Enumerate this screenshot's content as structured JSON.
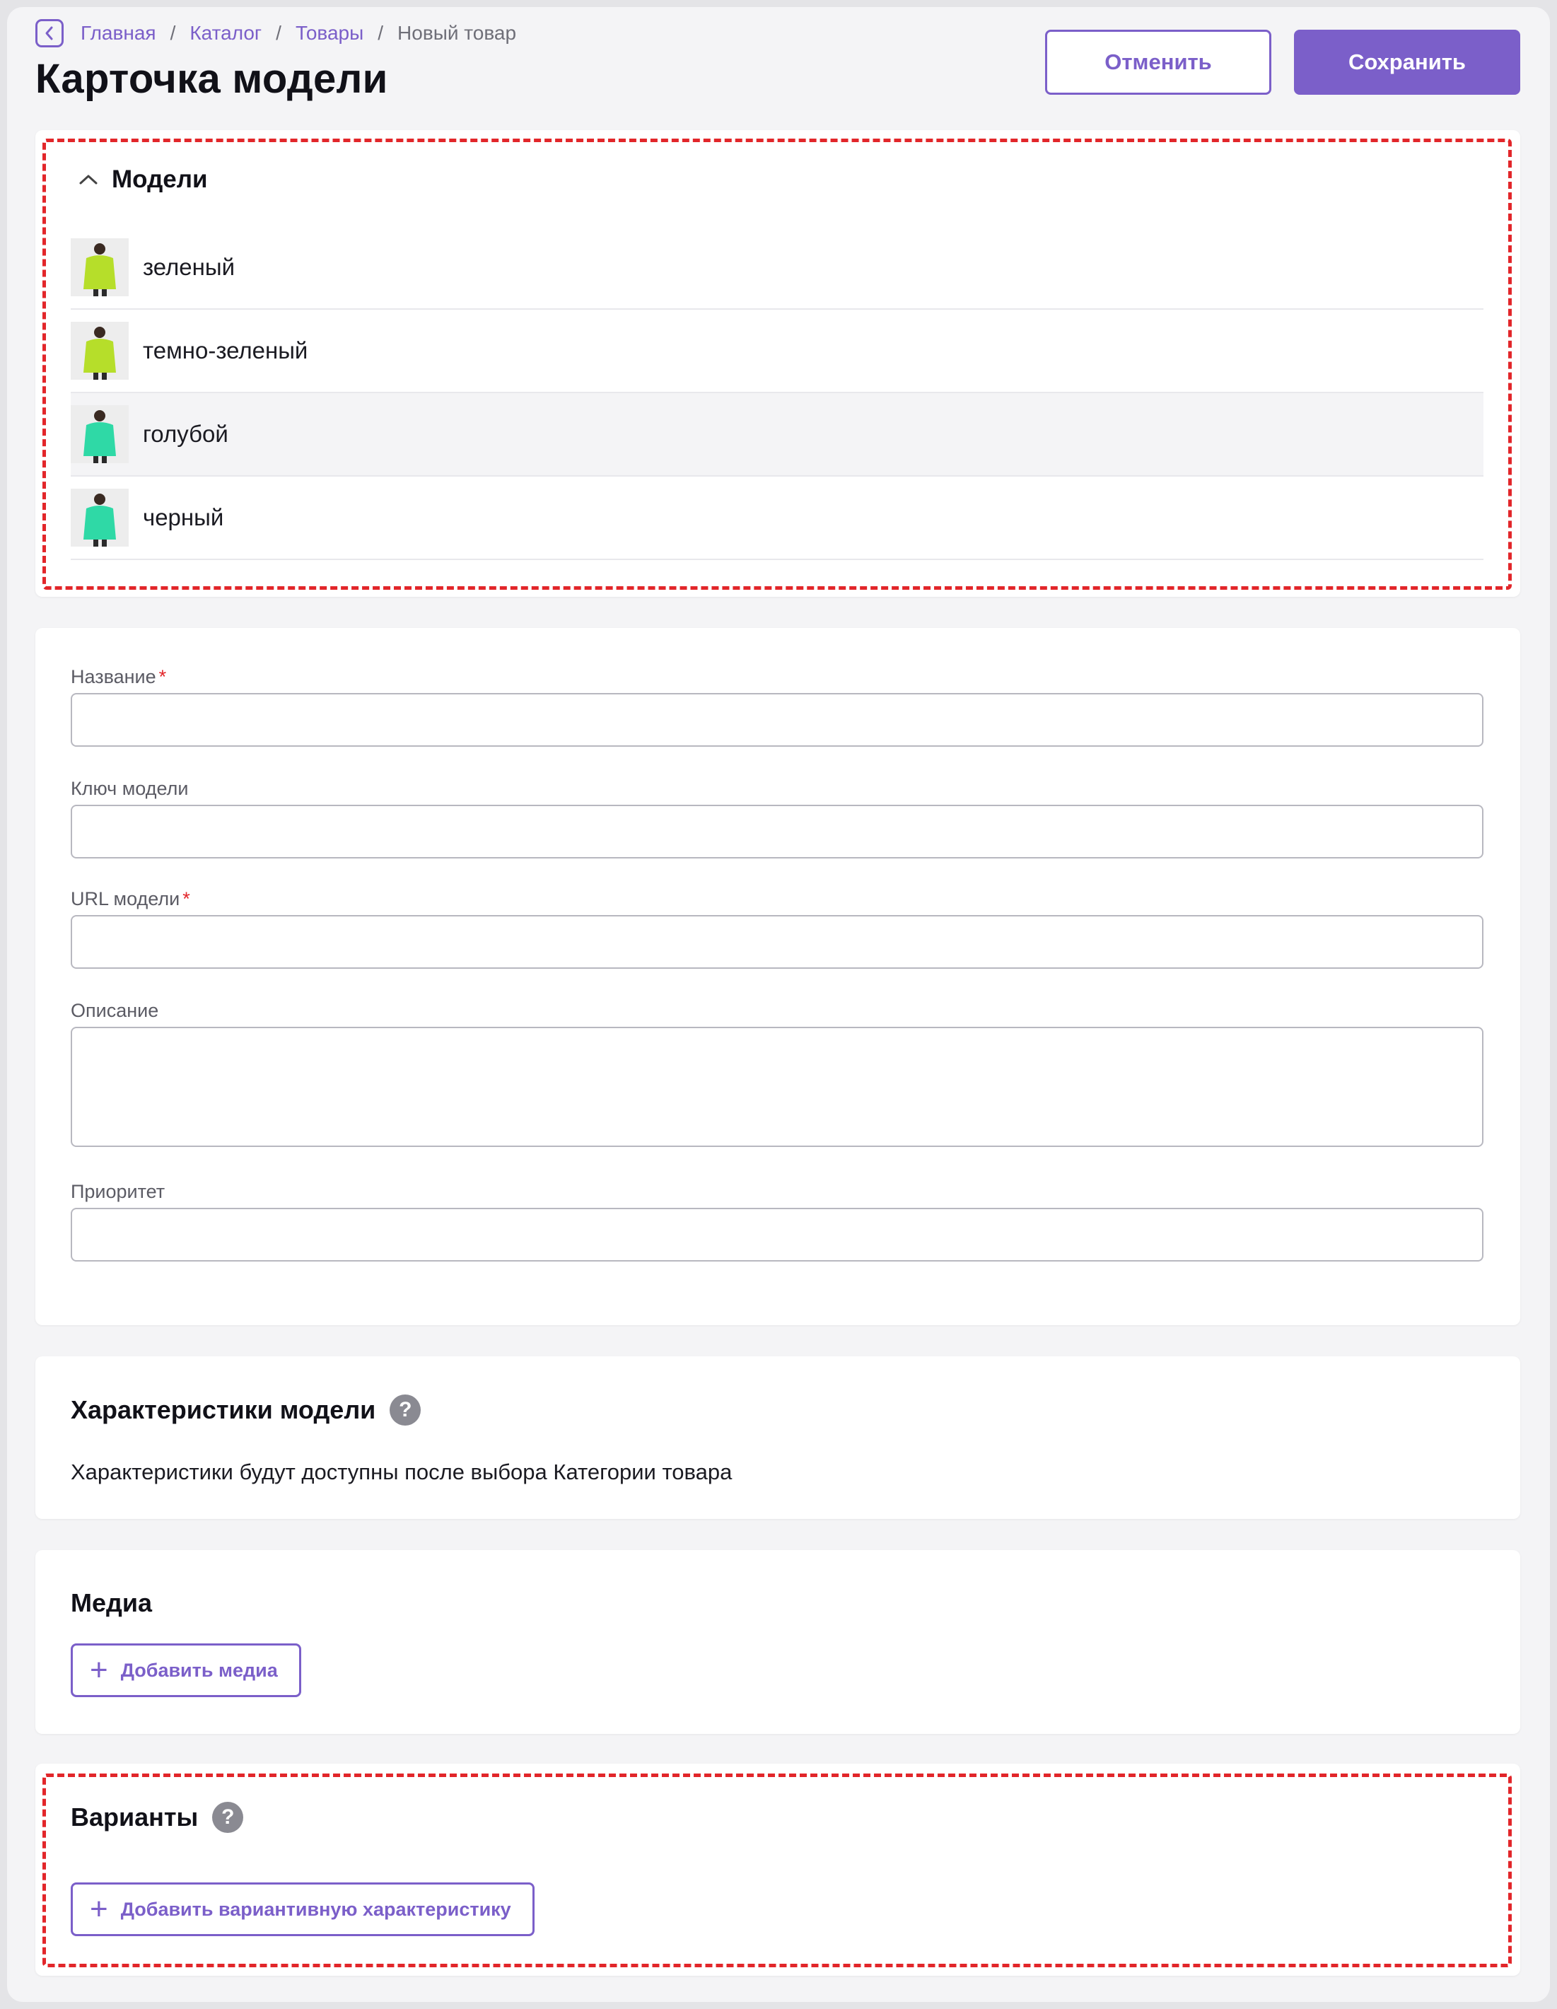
{
  "breadcrumb": {
    "items": [
      "Главная",
      "Каталог",
      "Товары"
    ],
    "current": "Новый товар",
    "separator": "/"
  },
  "page": {
    "title": "Карточка модели",
    "cancel_label": "Отменить",
    "save_label": "Сохранить"
  },
  "models": {
    "title": "Модели",
    "items": [
      {
        "label": "зеленый",
        "swatch": "#b6de2a"
      },
      {
        "label": "темно-зеленый",
        "swatch": "#b6de2a"
      },
      {
        "label": "голубой",
        "swatch": "#2fd9a6"
      },
      {
        "label": "черный",
        "swatch": "#2fd9a6"
      }
    ]
  },
  "form": {
    "name_label": "Название",
    "key_label": "Ключ модели",
    "url_label": "URL модели",
    "description_label": "Описание",
    "priority_label": "Приоритет",
    "required_mark": "*"
  },
  "characteristics": {
    "title": "Характеристики модели",
    "help": "?",
    "info": "Характеристики будут доступны после выбора Категории товара"
  },
  "media": {
    "title": "Медиа",
    "add_label": "Добавить медиа"
  },
  "variants": {
    "title": "Варианты",
    "help": "?",
    "add_label": "Добавить вариантивную характеристику"
  },
  "colors": {
    "accent": "#7b5fc9",
    "highlight": "#e2262a"
  }
}
